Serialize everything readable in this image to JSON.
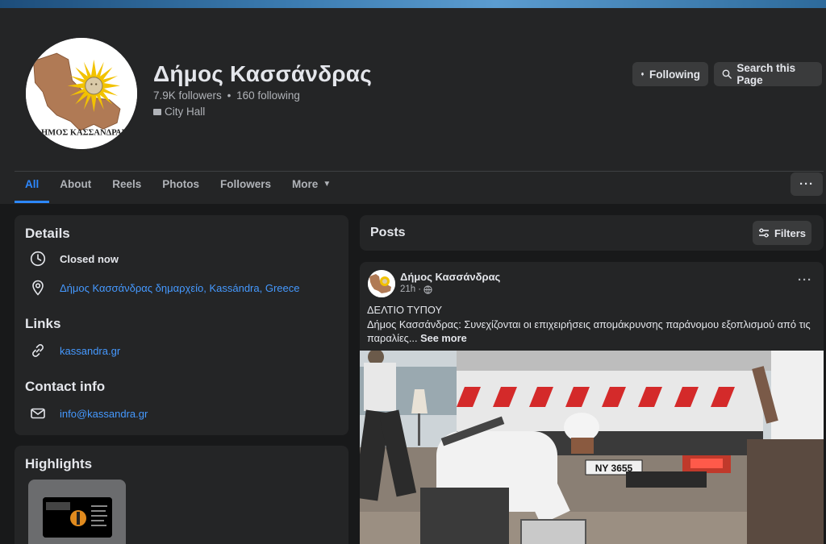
{
  "page": {
    "name": "Δήμος Κασσάνδρας",
    "followers": "7.9K followers",
    "following_count": "160 following",
    "separator": "•",
    "category": "City Hall",
    "logo_text": "ΔΗΜΟΣ ΚΑΣΣΑΝΔΡΑΣ"
  },
  "actions": {
    "following_label": "Following",
    "search_label": "Search this Page",
    "more_label": "···"
  },
  "tabs": [
    {
      "label": "All",
      "active": true
    },
    {
      "label": "About"
    },
    {
      "label": "Reels"
    },
    {
      "label": "Photos"
    },
    {
      "label": "Followers"
    },
    {
      "label": "More"
    }
  ],
  "details": {
    "title": "Details",
    "status": "Closed now",
    "address": "Δήμος Κασσάνδρας δημαρχείο, Kassándra, Greece",
    "links_title": "Links",
    "website": "kassandra.gr",
    "contact_title": "Contact info",
    "email": "info@kassandra.gr"
  },
  "highlights": {
    "title": "Highlights"
  },
  "posts": {
    "title": "Posts",
    "filters_label": "Filters"
  },
  "post": {
    "author": "Δήμος Κασσάνδρας",
    "time": "21h",
    "dot": "·",
    "menu": "···",
    "line1": "ΔΕΛΤΙΟ ΤΥΠΟΥ",
    "line2": "Δήμος Κασσάνδρας: Συνεχίζονται οι επιχειρήσεις απομάκρυνσης παράνομου εξοπλισμού από τις",
    "line3": "παραλίες...",
    "see_more": "See more",
    "plate_text": "NY 3655"
  },
  "colors": {
    "background": "#18191a",
    "card": "#242526",
    "button": "#3a3b3c",
    "accent": "#2d88ff",
    "link": "#4599ff",
    "text_secondary": "#b0b3b8"
  }
}
